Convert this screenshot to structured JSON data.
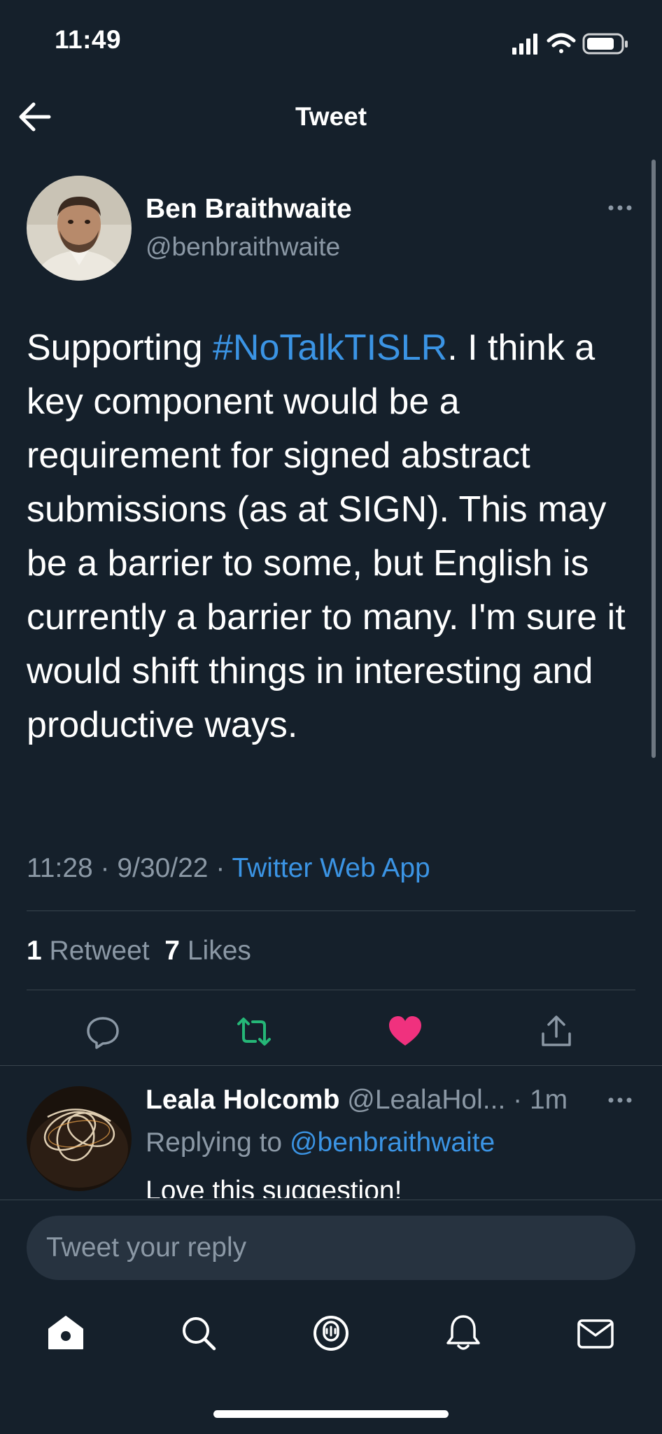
{
  "status_bar": {
    "time": "11:49"
  },
  "header": {
    "title": "Tweet"
  },
  "tweet": {
    "author_name": "Ben Braithwaite",
    "author_handle": "@benbraithwaite",
    "text_before": "Supporting ",
    "hashtag": "#NoTalkTISLR",
    "text_after": ". I think a key component would be a requirement for signed abstract submissions (as at SIGN). This may be a barrier to some, but English is currently a barrier to many. I'm sure it would shift things in interesting and productive ways.",
    "time": "11:28",
    "date": "9/30/22",
    "source": "Twitter Web App",
    "retweet_count": "1",
    "retweet_label": "Retweet",
    "like_count": "7",
    "like_label": "Likes",
    "liked": true,
    "retweeted": true
  },
  "reply": {
    "author_name": "Leala Holcomb",
    "author_handle": "@LealaHol...",
    "time": "1m",
    "replying_prefix": "Replying to",
    "replying_to": "@benbraithwaite",
    "text": "Love this suggestion!"
  },
  "compose": {
    "placeholder": "Tweet your reply"
  },
  "colors": {
    "background": "#15202b",
    "accent": "#3b94e4",
    "retweet": "#25b777",
    "like": "#f0317e",
    "muted": "#8b98a5"
  },
  "tab_bar": {
    "items": [
      "home-icon",
      "search-icon",
      "spaces-icon",
      "notifications-icon",
      "messages-icon"
    ]
  }
}
